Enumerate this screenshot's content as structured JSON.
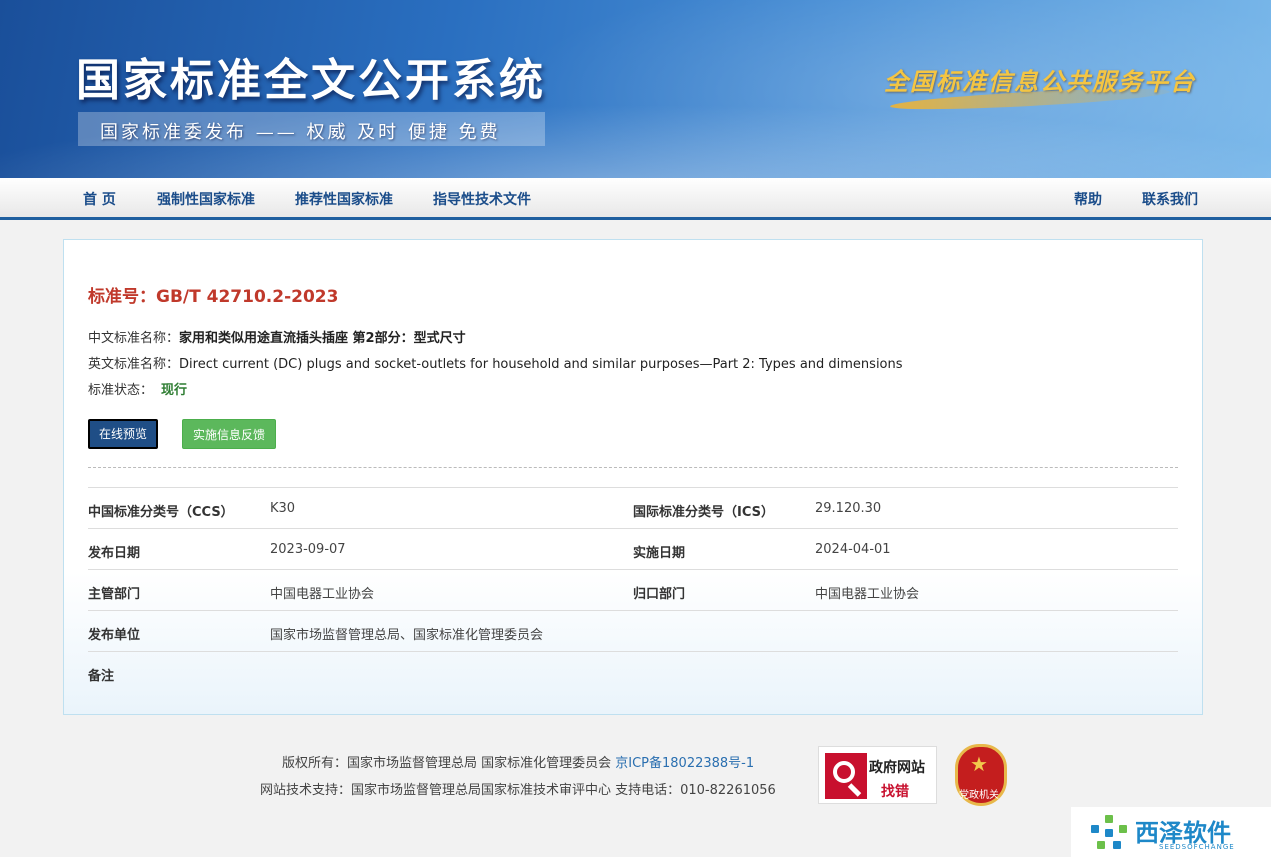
{
  "header": {
    "site_title": "国家标准全文公开系统",
    "tagline": "国家标准委发布 —— 权威 及时 便捷 免费",
    "platform": "全国标准信息公共服务平台"
  },
  "nav": {
    "items": [
      "首 页",
      "强制性国家标准",
      "推荐性国家标准",
      "指导性技术文件"
    ],
    "right_items": [
      "帮助",
      "联系我们"
    ]
  },
  "standard": {
    "number_label": "标准号：",
    "number": "GB/T 42710.2-2023",
    "cn_name_label": "中文标准名称：",
    "cn_name": "家用和类似用途直流插头插座 第2部分：型式尺寸",
    "en_name_label": "英文标准名称：",
    "en_name": "Direct current (DC) plugs and socket-outlets for household and similar purposes—Part 2: Types and dimensions",
    "status_label": "标准状态：",
    "status": "现行"
  },
  "buttons": {
    "preview": "在线预览",
    "feedback": "实施信息反馈"
  },
  "details": {
    "ccs_label": "中国标准分类号（CCS）",
    "ccs": "K30",
    "ics_label": "国际标准分类号（ICS）",
    "ics": "29.120.30",
    "publish_date_label": "发布日期",
    "publish_date": "2023-09-07",
    "impl_date_label": "实施日期",
    "impl_date": "2024-04-01",
    "authority_label": "主管部门",
    "authority": "中国电器工业协会",
    "central_label": "归口部门",
    "central": "中国电器工业协会",
    "issuer_label": "发布单位",
    "issuer": "国家市场监督管理总局、国家标准化管理委员会",
    "remark_label": "备注"
  },
  "footer": {
    "copyright_prefix": "版权所有：国家市场监督管理总局 国家标准化管理委员会 ",
    "icp": "京ICP备18022388号-1",
    "support": "网站技术支持：国家市场监督管理总局国家标准技术审评中心 支持电话：010-82261056",
    "badge_find_top": "政府网站",
    "badge_find_bottom": "找错",
    "badge_party": "党政机关"
  },
  "watermark": {
    "name": "西泽软件",
    "sub": "SEEDSOFCHANGE"
  },
  "colors": {
    "banner_blue": "#2a6fc0",
    "nav_text": "#1b4d8a",
    "std_red": "#c0392b",
    "status_green": "#2e7d32",
    "preview_btn": "#1f4e86",
    "feedback_btn": "#5cb85c"
  }
}
